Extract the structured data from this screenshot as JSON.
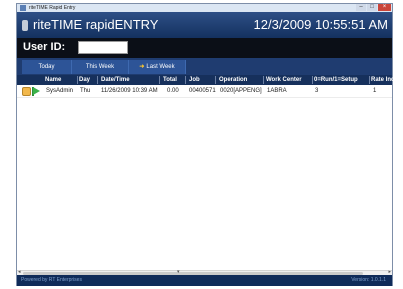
{
  "window": {
    "title": "riteTIME Rapid Entry",
    "min": "–",
    "max": "□",
    "close": "×"
  },
  "header": {
    "app_title": "riteTIME rapidENTRY",
    "clock": "12/3/2009 10:55:51 AM"
  },
  "user": {
    "label": "User ID:",
    "value": ""
  },
  "tabs": {
    "today": "Today",
    "this_week": "This Week",
    "last_week": "Last Week"
  },
  "grid": {
    "columns": [
      "Name",
      "Day",
      "Date/Time",
      "Total",
      "Job",
      "Operation",
      "Work Center",
      "0=Run/1=Setup",
      "Rate Ind"
    ],
    "rows": [
      {
        "name": "SysAdmin",
        "day": "Thu",
        "datetime": "11/26/2009 10:39 AM",
        "total": "0.00",
        "job": "00400571",
        "operation": "0020[APPENG]",
        "work_center": "1ABRA",
        "run_setup": "3",
        "rate": "1"
      }
    ]
  },
  "footer": {
    "powered": "Powered by RT Enterprises",
    "version": "Version: 1.0.1.1"
  },
  "colors": {
    "header_bg": "#1e3e72",
    "tab_bg": "#2d5497",
    "accent": "#f7c531"
  }
}
